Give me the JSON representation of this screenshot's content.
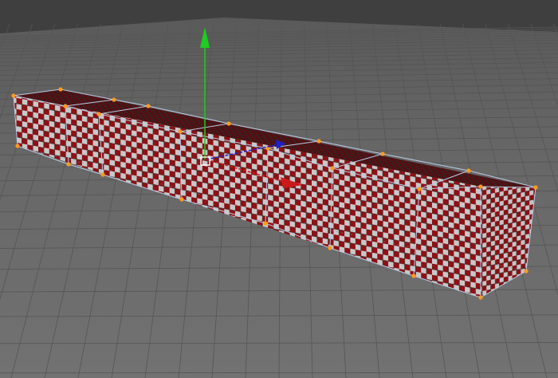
{
  "scene": {
    "background_color": "#3f3f3f",
    "ground_color": "#6e6e6e",
    "grid_color": "#5a5a5a",
    "horizon_color": "#4a4a4a",
    "object": {
      "type": "segmented-box",
      "segments": 6,
      "texture": "checker",
      "checker_colors": [
        "#8f1015",
        "#c8c8c8"
      ],
      "wireframe_color": "#b8cbe6",
      "vertex_color": "#ff9a1a",
      "selected": true
    },
    "gizmo": {
      "type": "move-gizmo",
      "x_axis_color": "#cc1a1a",
      "y_axis_color": "#1fcc1f",
      "z_axis_color": "#2020cc",
      "pivot_color": "#ffffff"
    }
  }
}
